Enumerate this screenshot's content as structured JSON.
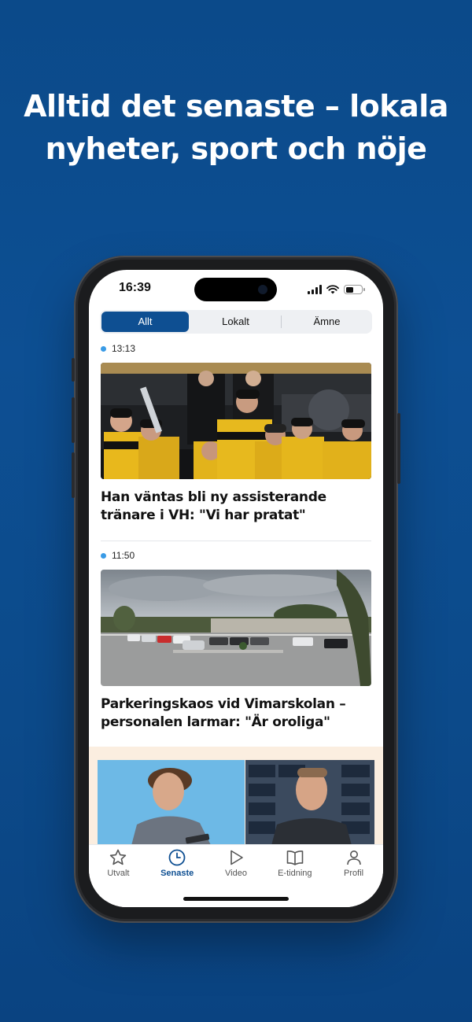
{
  "promo": {
    "headline_line1": "Alltid det senaste – lokala",
    "headline_line2": "nyheter, sport och nöje"
  },
  "status_bar": {
    "time": "16:39"
  },
  "segments": [
    {
      "label": "Allt",
      "selected": true
    },
    {
      "label": "Lokalt",
      "selected": false
    },
    {
      "label": "Ämne",
      "selected": false
    }
  ],
  "articles": [
    {
      "time": "13:13",
      "title": "Han väntas bli ny assisterande tränare i VH: \"Vi har pratat\""
    },
    {
      "time": "11:50",
      "title": "Parkeringskaos vid Vimarskolan – personalen larmar: \"Är oroliga\""
    }
  ],
  "tabbar": [
    {
      "label": "Utvalt",
      "icon": "star-icon",
      "active": false
    },
    {
      "label": "Senaste",
      "icon": "clock-icon",
      "active": true
    },
    {
      "label": "Video",
      "icon": "play-icon",
      "active": false
    },
    {
      "label": "E-tidning",
      "icon": "book-icon",
      "active": false
    },
    {
      "label": "Profil",
      "icon": "person-icon",
      "active": false
    }
  ],
  "colors": {
    "background": "#0d4f93",
    "accent": "#0e4f92",
    "live_dot": "#3a9be6",
    "ad_band": "#fbeee0"
  }
}
